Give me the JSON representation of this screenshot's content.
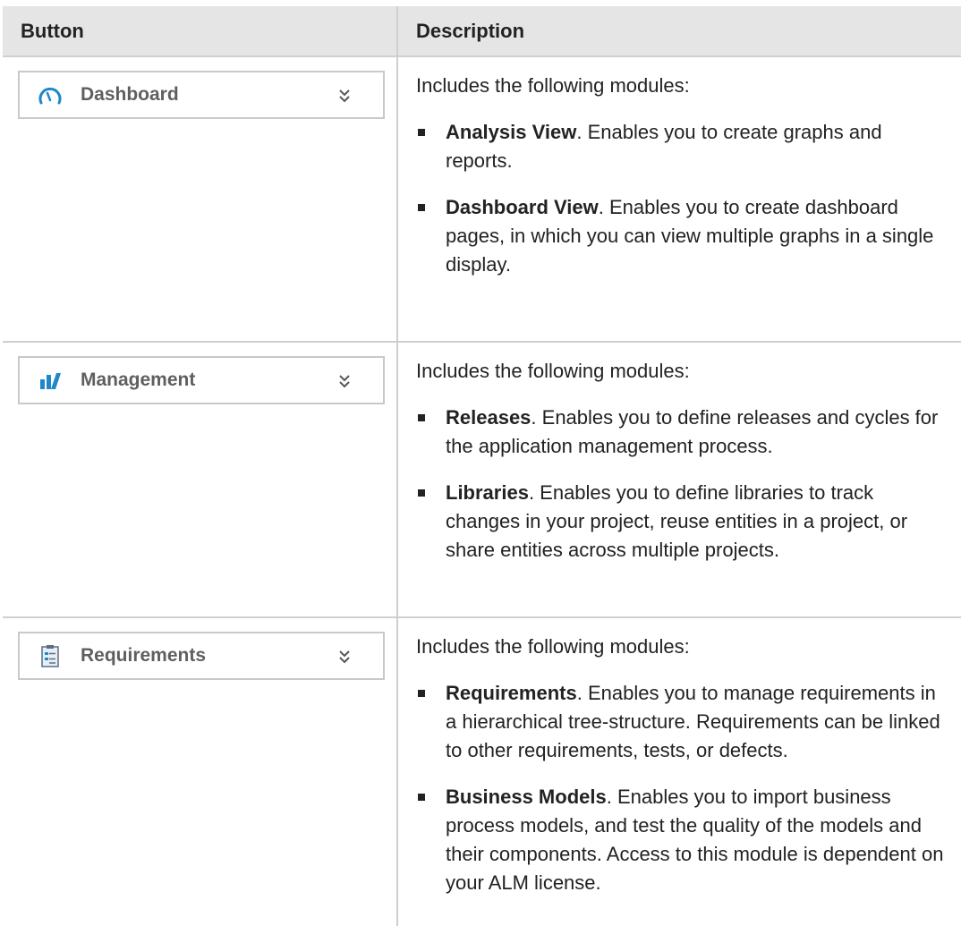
{
  "header": {
    "col_button": "Button",
    "col_description": "Description"
  },
  "rows": [
    {
      "button_label": "Dashboard",
      "icon": "dashboard-gauge-icon",
      "intro": "Includes the following modules:",
      "items": [
        {
          "term": "Analysis View",
          "text": ". Enables you to create graphs and reports."
        },
        {
          "term": "Dashboard View",
          "text": ". Enables you to create dashboard pages, in which you can view multiple graphs in a single display."
        }
      ]
    },
    {
      "button_label": "Management",
      "icon": "management-chart-icon",
      "intro": "Includes the following modules:",
      "items": [
        {
          "term": "Releases",
          "text": ". Enables you to define releases and cycles for the application management process."
        },
        {
          "term": "Libraries",
          "text": ". Enables you to define libraries to track changes in your project, reuse entities in a project, or share entities across multiple projects."
        }
      ]
    },
    {
      "button_label": "Requirements",
      "icon": "requirements-clipboard-icon",
      "intro": "Includes the following modules:",
      "items": [
        {
          "term": "Requirements",
          "text": ". Enables you to manage requirements in a hierarchical tree-structure. Requirements can be linked to other requirements, tests, or defects."
        },
        {
          "term": "Business Models",
          "text": ". Enables you to import business process models, and test the quality of the models and their components. Access to this module is dependent on your ALM license."
        }
      ]
    }
  ],
  "colors": {
    "header_bg": "#e5e5e5",
    "border": "#cfcfcf",
    "icon_blue": "#1e88c8",
    "button_text": "#5f5f5f"
  }
}
